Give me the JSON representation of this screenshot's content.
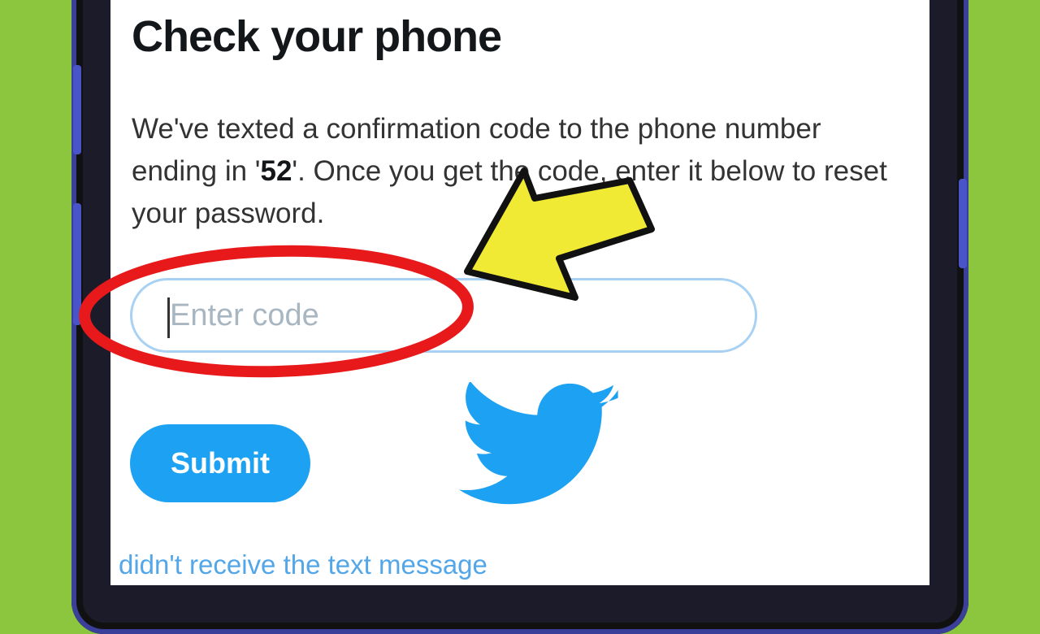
{
  "screen": {
    "title": "Check your phone",
    "description_part1": "We've texted a confirmation code to the phone number ending in '",
    "phone_digits": "52",
    "description_part2": "'. Once you get the code, enter it below to reset your password.",
    "code_input": {
      "placeholder": "Enter code",
      "value": ""
    },
    "submit_label": "Submit",
    "resend_link": "didn't receive the text message"
  },
  "icons": {
    "logo": "twitter-bird-icon",
    "annotation_arrow": "yellow-arrow-icon",
    "annotation_circle": "red-circle-highlight"
  },
  "colors": {
    "brand_blue": "#1da1f2",
    "input_border": "#a9d1f3",
    "link_blue": "#53a7e8",
    "background_green": "#8cc63f",
    "highlight_red": "#e8191b",
    "arrow_yellow": "#f0ea35"
  }
}
